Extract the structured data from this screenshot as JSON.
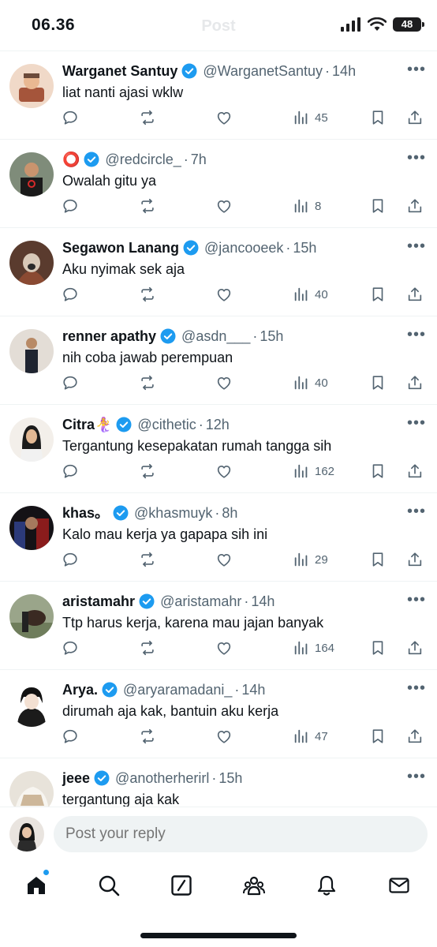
{
  "status_bar": {
    "time": "06.36",
    "battery": "48",
    "ghost_title": "Post"
  },
  "replies": [
    {
      "name": "Warganet Santuy",
      "handle": "@WarganetSantuy",
      "time": "14h",
      "text": "liat nanti ajasi wklw",
      "views": "45"
    },
    {
      "name": "⭕",
      "handle": "@redcircle_",
      "time": "7h",
      "text": "Owalah gitu ya",
      "views": "8"
    },
    {
      "name": "Segawon Lanang",
      "handle": "@jancooeek",
      "time": "15h",
      "text": "Aku nyimak sek aja",
      "views": "40"
    },
    {
      "name": "renner apathy",
      "handle": "@asdn___",
      "time": "15h",
      "text": "nih coba jawab perempuan",
      "views": "40"
    },
    {
      "name": "Citra🧜‍♀️",
      "handle": "@cithetic",
      "time": "12h",
      "text": "Tergantung kesepakatan rumah tangga sih",
      "views": "162"
    },
    {
      "name": "khas。",
      "handle": "@khasmuyk",
      "time": "8h",
      "text": "Kalo mau kerja ya gapapa sih ini",
      "views": "29"
    },
    {
      "name": "aristamahr",
      "handle": "@aristamahr",
      "time": "14h",
      "text": "Ttp harus kerja, karena mau jajan banyak",
      "views": "164"
    },
    {
      "name": "Arya.",
      "handle": "@aryaramadani_",
      "time": "14h",
      "text": "dirumah aja kak, bantuin aku kerja",
      "views": "47"
    },
    {
      "name": "jeee",
      "handle": "@anotherherirl",
      "time": "15h",
      "text": "tergantung aja kak",
      "views": ""
    }
  ],
  "reply_bar": {
    "placeholder": "Post your reply"
  },
  "tabs": [
    "home-icon",
    "search-icon",
    "grok-icon",
    "communities-icon",
    "notifications-icon",
    "messages-icon"
  ],
  "colors": {
    "verified": "#1d9bf0",
    "text": "#0f1419",
    "muted": "#536471",
    "divider": "#eff3f4"
  }
}
